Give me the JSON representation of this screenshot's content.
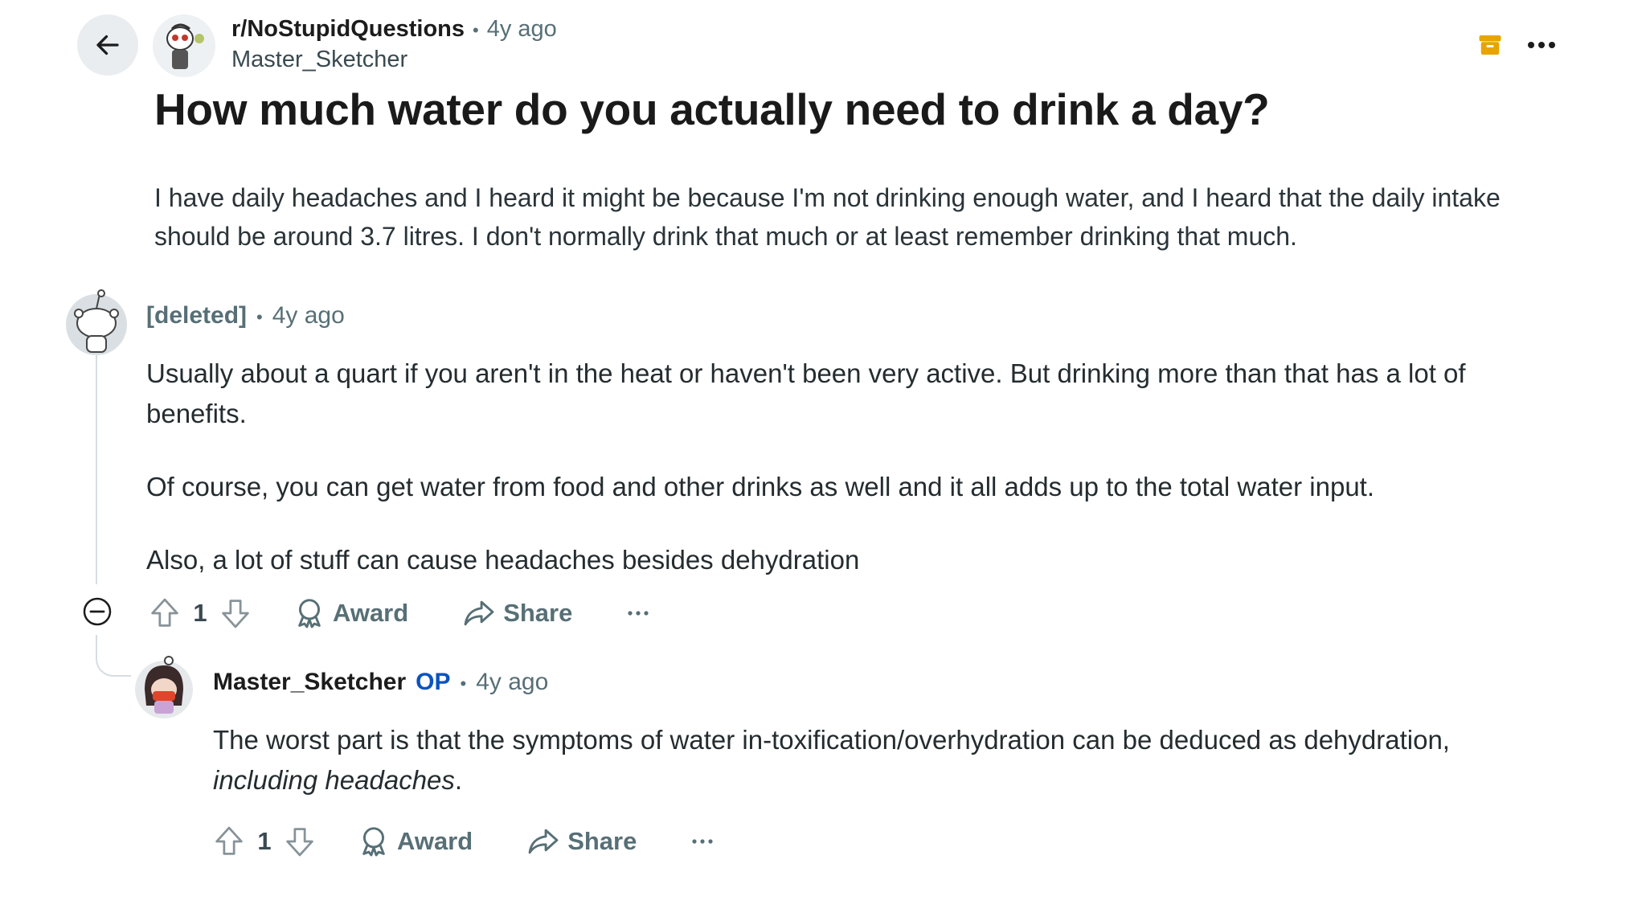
{
  "header": {
    "subreddit": "r/NoStupidQuestions",
    "separator": "•",
    "age": "4y ago",
    "author": "Master_Sketcher",
    "icons": [
      "back-arrow-icon",
      "archive-icon",
      "more-options-icon"
    ],
    "archive_icon_color": "#e8a400"
  },
  "post": {
    "title": "How much water do you actually need to drink a day?",
    "body": "I have daily headaches and I heard it might be because I'm not drinking enough water, and I heard that the daily intake should be around 3.7 litres. I don't normally drink that much or at least remember drinking that much."
  },
  "comments": [
    {
      "author": "[deleted]",
      "separator": "•",
      "age": "4y ago",
      "paragraphs": [
        "Usually about a quart if you aren't in the heat or haven't been very active. But drinking more than that has a lot of benefits.",
        "Of course, you can get water from food and other drinks as well and it all adds up to the total water input.",
        "Also, a lot of stuff can cause headaches besides dehydration"
      ],
      "score": "1",
      "award_label": "Award",
      "share_label": "Share"
    },
    {
      "author": "Master_Sketcher",
      "badge": "OP",
      "separator": "•",
      "age": "4y ago",
      "body_before": "The worst part is that the symptoms of water in-toxification/overhydration can be deduced as dehydration, ",
      "body_italic": "including headaches",
      "body_after": ".",
      "score": "1",
      "award_label": "Award",
      "share_label": "Share"
    }
  ],
  "colors": {
    "meta_gray": "#576f76",
    "op_blue": "#0a53be",
    "back_button_bg": "#e9edf0"
  }
}
